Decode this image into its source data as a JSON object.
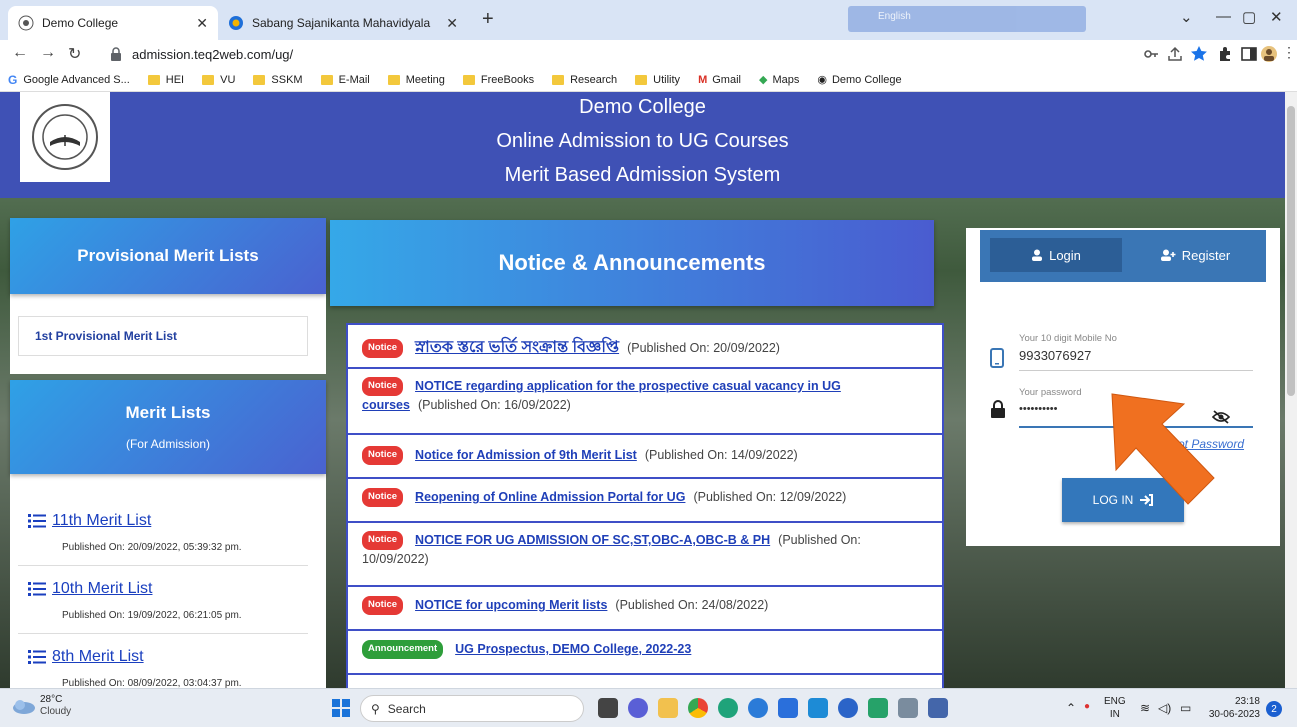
{
  "browser": {
    "tabs": [
      {
        "title": "Demo College",
        "active": true
      },
      {
        "title": "Sabang Sajanikanta Mahavidyala",
        "active": false
      }
    ],
    "ext_text": "English",
    "url": "admission.teq2web.com/ug/",
    "bookmarks": [
      {
        "label": "Google Advanced S...",
        "type": "google"
      },
      {
        "label": "HEI",
        "type": "folder"
      },
      {
        "label": "VU",
        "type": "folder"
      },
      {
        "label": "SSKM",
        "type": "folder"
      },
      {
        "label": "E-Mail",
        "type": "folder"
      },
      {
        "label": "Meeting",
        "type": "folder"
      },
      {
        "label": "FreeBooks",
        "type": "folder"
      },
      {
        "label": "Research",
        "type": "folder"
      },
      {
        "label": "Utility",
        "type": "folder"
      },
      {
        "label": "Gmail",
        "type": "gmail"
      },
      {
        "label": "Maps",
        "type": "maps"
      },
      {
        "label": "Demo College",
        "type": "site"
      }
    ]
  },
  "header": {
    "line1": "Demo College",
    "line2": "Online Admission to UG Courses",
    "line3": "Merit Based Admission System"
  },
  "provisional": {
    "title": "Provisional Merit Lists",
    "item": "1st Provisional Merit List"
  },
  "merit": {
    "title": "Merit Lists",
    "subtitle": "(For Admission)",
    "items": [
      {
        "label": "11th Merit List",
        "published": "Published On: 20/09/2022, 05:39:32 pm."
      },
      {
        "label": "10th Merit List",
        "published": "Published On: 19/09/2022, 06:21:05 pm."
      },
      {
        "label": "8th Merit List",
        "published": "Published On: 08/09/2022, 03:04:37 pm."
      }
    ]
  },
  "notices": {
    "title": "Notice & Announcements",
    "items": [
      {
        "badge": "Notice",
        "link": "স্নাতক স্তরে ভর্তি সংক্রান্ত বিজ্ঞপ্তি",
        "published": "(Published On: 20/09/2022)"
      },
      {
        "badge": "Notice",
        "link": "NOTICE regarding application for the prospective casual vacancy in UG courses",
        "published": "(Published On: 16/09/2022)"
      },
      {
        "badge": "Notice",
        "link": "Notice for Admission of 9th Merit List",
        "published": "(Published On: 14/09/2022)"
      },
      {
        "badge": "Notice",
        "link": "Reopening of Online Admission Portal for UG",
        "published": "(Published On: 12/09/2022)"
      },
      {
        "badge": "Notice",
        "link": "NOTICE FOR UG ADMISSION OF SC,ST,OBC-A,OBC-B & PH",
        "published": "(Published On: 10/09/2022)"
      },
      {
        "badge": "Notice",
        "link": "NOTICE for upcoming Merit lists",
        "published": "(Published On: 24/08/2022)"
      },
      {
        "badge": "Announcement",
        "link": "UG Prospectus, DEMO College, 2022-23",
        "published": ""
      }
    ]
  },
  "login": {
    "tab_login": "Login",
    "tab_register": "Register",
    "mobile_label": "Your 10 digit Mobile No",
    "mobile_value": "9933076927",
    "password_label": "Your password",
    "password_value": "••••••••••",
    "forgot": "ot Password",
    "button": "LOG IN"
  },
  "taskbar": {
    "temp": "28°C",
    "weather": "Cloudy",
    "search": "Search",
    "lang1": "ENG",
    "lang2": "IN",
    "time": "23:18",
    "date": "30-06-2023",
    "notif_count": "2"
  },
  "colors": {
    "header_bg": "#3f51b5",
    "card_gradient_start": "#2fa1e6",
    "notice_border": "#3f4fc7",
    "badge_red": "#e53935",
    "badge_green": "#2e9e3a",
    "annotation_arrow": "#f07020"
  }
}
